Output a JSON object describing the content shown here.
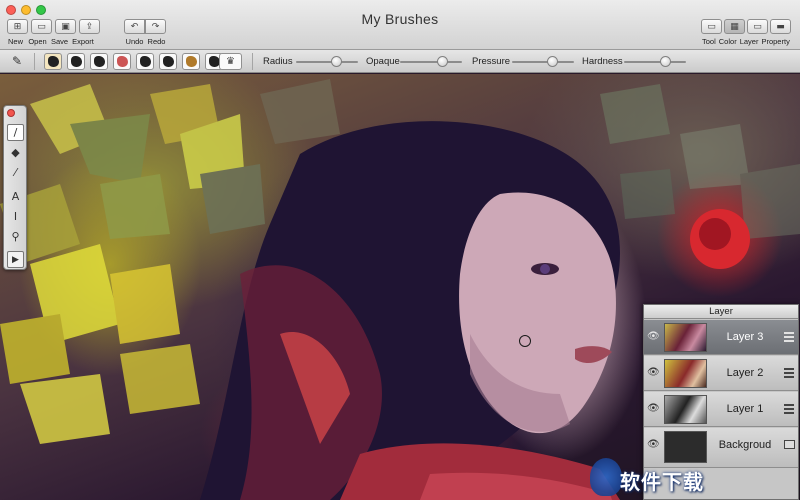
{
  "window": {
    "title": "My Brushes"
  },
  "toolbar_left": {
    "buttons": [
      {
        "label": "New",
        "icon": "new-document-icon"
      },
      {
        "label": "Open",
        "icon": "open-folder-icon"
      },
      {
        "label": "Save",
        "icon": "save-disk-icon"
      },
      {
        "label": "Export",
        "icon": "export-icon"
      }
    ],
    "history": [
      {
        "label": "Undo",
        "icon": "undo-arrow-icon",
        "glyph": "↶"
      },
      {
        "label": "Redo",
        "icon": "redo-arrow-icon",
        "glyph": "↷"
      }
    ]
  },
  "toolbar_right": {
    "buttons": [
      {
        "label": "Tool",
        "icon": "tool-panel-icon"
      },
      {
        "label": "Color",
        "icon": "color-panel-icon"
      },
      {
        "label": "Layer",
        "icon": "layer-panel-icon"
      },
      {
        "label": "Property",
        "icon": "property-panel-icon"
      }
    ]
  },
  "brush_bar": {
    "brush_count": 8,
    "sliders": [
      {
        "label": "Radius",
        "value": 0.6
      },
      {
        "label": "Opaque",
        "value": 0.62
      },
      {
        "label": "Pressure",
        "value": 0.62
      },
      {
        "label": "Hardness",
        "value": 0.62
      }
    ]
  },
  "tools": [
    {
      "name": "brush-tool-icon",
      "glyph": "/"
    },
    {
      "name": "eraser-tool-icon",
      "glyph": "◆"
    },
    {
      "name": "eyedropper-tool-icon",
      "glyph": "⁄"
    },
    {
      "name": "text-tool-icon",
      "glyph": "A"
    },
    {
      "name": "text-cursor-tool-icon",
      "glyph": "I"
    },
    {
      "name": "zoom-tool-icon",
      "glyph": "⚲"
    },
    {
      "name": "play-tool-icon",
      "glyph": "▶"
    }
  ],
  "layer_panel": {
    "title": "Layer",
    "layers": [
      {
        "name": "Layer 3",
        "selected": true
      },
      {
        "name": "Layer 2",
        "selected": false
      },
      {
        "name": "Layer 1",
        "selected": false
      },
      {
        "name": "Backgroud",
        "selected": false
      }
    ]
  },
  "watermark": {
    "text": "软件下载"
  }
}
